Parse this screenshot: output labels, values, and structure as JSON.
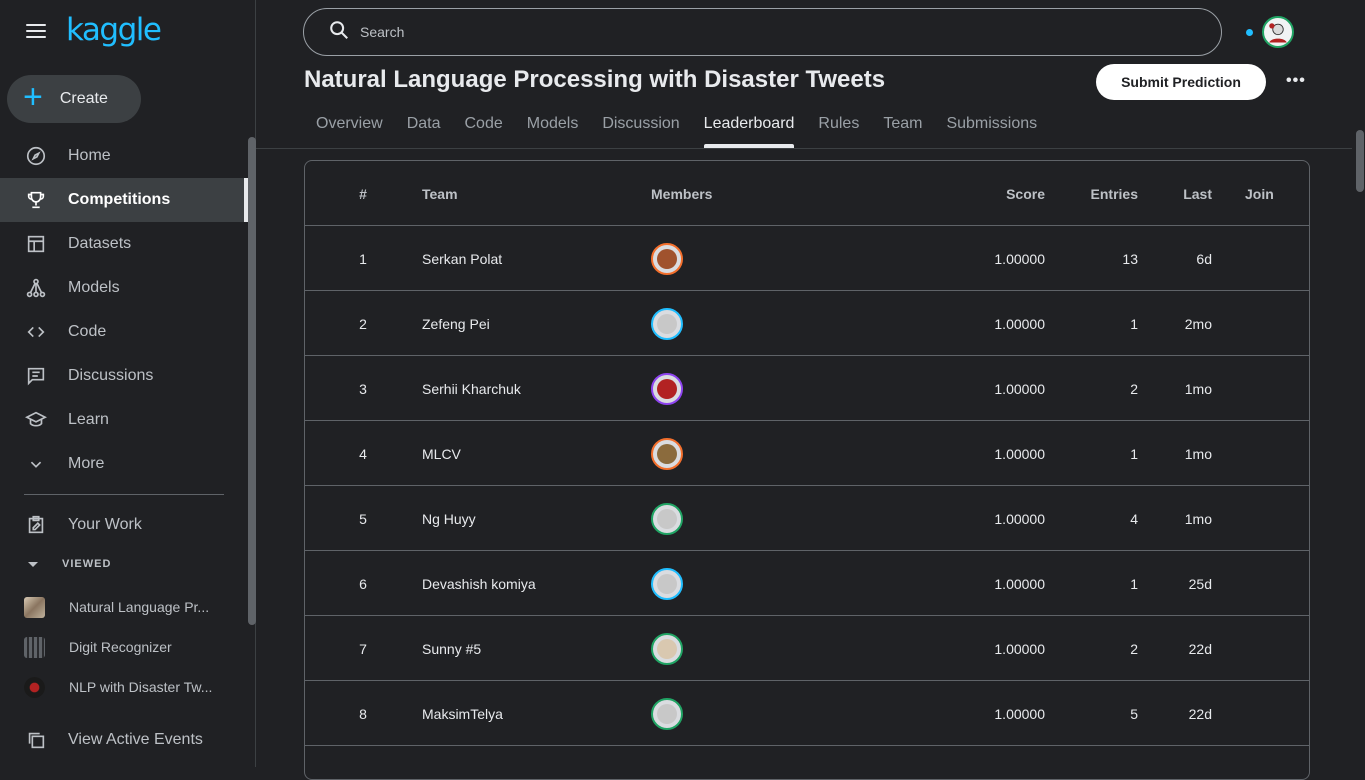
{
  "brand": {
    "logo": "kaggle",
    "accent": "#20beff"
  },
  "sidebar": {
    "create_label": "Create",
    "nav": [
      {
        "label": "Home",
        "icon": "compass-icon",
        "active": false
      },
      {
        "label": "Competitions",
        "icon": "trophy-icon",
        "active": true
      },
      {
        "label": "Datasets",
        "icon": "table-icon",
        "active": false
      },
      {
        "label": "Models",
        "icon": "models-icon",
        "active": false
      },
      {
        "label": "Code",
        "icon": "code-icon",
        "active": false
      },
      {
        "label": "Discussions",
        "icon": "discussion-icon",
        "active": false
      },
      {
        "label": "Learn",
        "icon": "graduation-cap-icon",
        "active": false
      },
      {
        "label": "More",
        "icon": "chevron-down-icon",
        "active": false
      }
    ],
    "your_work": "Your Work",
    "viewed_label": "VIEWED",
    "viewed": [
      {
        "label": "Natural Language Pr..."
      },
      {
        "label": "Digit Recognizer"
      },
      {
        "label": "NLP with Disaster Tw..."
      }
    ],
    "view_active_events": "View Active Events"
  },
  "search": {
    "placeholder": "Search"
  },
  "page": {
    "title": "Natural Language Processing with Disaster Tweets",
    "submit_label": "Submit Prediction",
    "more_label": "•••",
    "tabs": [
      "Overview",
      "Data",
      "Code",
      "Models",
      "Discussion",
      "Leaderboard",
      "Rules",
      "Team",
      "Submissions"
    ],
    "active_tab": "Leaderboard"
  },
  "leaderboard": {
    "headers": {
      "rank": "#",
      "team": "Team",
      "members": "Members",
      "score": "Score",
      "entries": "Entries",
      "last": "Last",
      "join": "Join"
    },
    "rows": [
      {
        "rank": "1",
        "team": "Serkan Polat",
        "score": "1.00000",
        "entries": "13",
        "last": "6d",
        "ring": "#f36f2c",
        "fill": "#a0522d"
      },
      {
        "rank": "2",
        "team": "Zefeng Pei",
        "score": "1.00000",
        "entries": "1",
        "last": "2mo",
        "ring": "#20beff",
        "fill": "#c8c8c8"
      },
      {
        "rank": "3",
        "team": "Serhii Kharchuk",
        "score": "1.00000",
        "entries": "2",
        "last": "1mo",
        "ring": "#8e44ef",
        "fill": "#b22222"
      },
      {
        "rank": "4",
        "team": "MLCV",
        "score": "1.00000",
        "entries": "1",
        "last": "1mo",
        "ring": "#f36f2c",
        "fill": "#8b6b3d"
      },
      {
        "rank": "5",
        "team": "Ng Huyy",
        "score": "1.00000",
        "entries": "4",
        "last": "1mo",
        "ring": "#20a464",
        "fill": "#c8c8c8"
      },
      {
        "rank": "6",
        "team": "Devashish komiya",
        "score": "1.00000",
        "entries": "1",
        "last": "25d",
        "ring": "#20beff",
        "fill": "#c8c8c8"
      },
      {
        "rank": "7",
        "team": "Sunny #5",
        "score": "1.00000",
        "entries": "2",
        "last": "22d",
        "ring": "#20a464",
        "fill": "#d9c8b0"
      },
      {
        "rank": "8",
        "team": "MaksimTelya",
        "score": "1.00000",
        "entries": "5",
        "last": "22d",
        "ring": "#20a464",
        "fill": "#c8c8c8"
      }
    ]
  }
}
